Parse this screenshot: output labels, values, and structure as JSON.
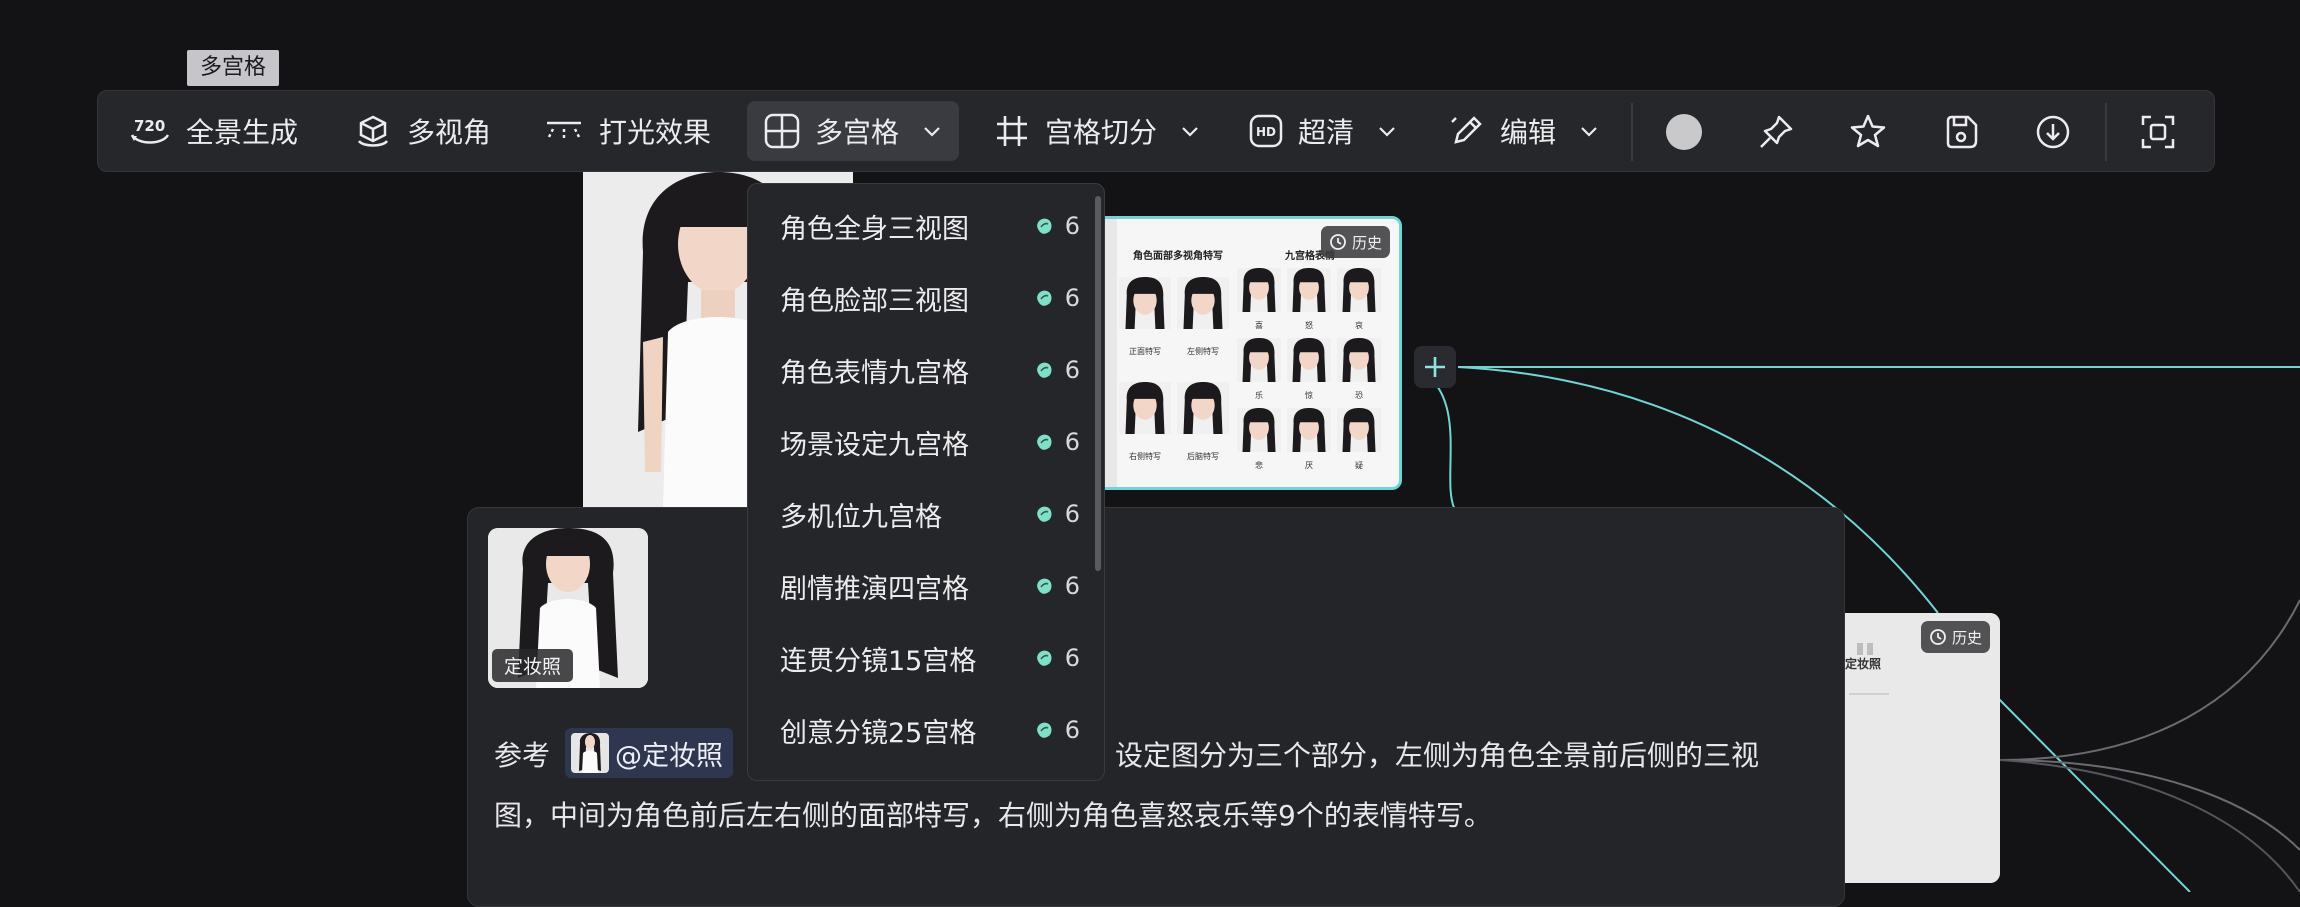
{
  "tooltip": "多宫格",
  "toolbar": {
    "items": [
      {
        "label": "全景生成",
        "icon": "720-panorama-icon"
      },
      {
        "label": "多视角",
        "icon": "cube-rotate-icon"
      },
      {
        "label": "打光效果",
        "icon": "lighting-icon"
      },
      {
        "label": "多宫格",
        "icon": "grid-icon",
        "active": true
      },
      {
        "label": "宫格切分",
        "icon": "hash-split-icon"
      },
      {
        "label": "超清",
        "icon": "hd-icon"
      },
      {
        "label": "编辑",
        "icon": "pen-edit-icon"
      }
    ],
    "right_icons": [
      "color-circle-icon",
      "pin-icon",
      "star-icon",
      "save-icon",
      "download-icon",
      "fit-screen-icon"
    ]
  },
  "dropdown": {
    "cost_icon": "bean-icon",
    "items": [
      {
        "label": "角色全身三视图",
        "cost": "6"
      },
      {
        "label": "角色脸部三视图",
        "cost": "6"
      },
      {
        "label": "角色表情九宫格",
        "cost": "6"
      },
      {
        "label": "场景设定九宫格",
        "cost": "6"
      },
      {
        "label": "多机位九宫格",
        "cost": "6"
      },
      {
        "label": "剧情推演四宫格",
        "cost": "6"
      },
      {
        "label": "连贯分镜15宫格",
        "cost": "6"
      },
      {
        "label": "创意分镜25宫格",
        "cost": "6"
      }
    ]
  },
  "grid_card": {
    "history": "历史",
    "left_title": "角色面部多视角特写",
    "right_title": "九宫格表情",
    "face_labels": [
      "正面特写",
      "左侧特写",
      "右侧特写",
      "后脑特写"
    ],
    "emotion_labels": [
      "喜",
      "怒",
      "哀",
      "乐",
      "惊",
      "恐",
      "悲",
      "厌",
      "疑"
    ]
  },
  "right_card": {
    "history": "历史",
    "title": "定妆照"
  },
  "editor": {
    "thumb_label": "定妆照",
    "prefix": "参考",
    "chip_label": "@定妆照",
    "line1_rest": "设定图分为三个部分，左侧为角色全景前后侧的三视",
    "line2": "图，中间为角色前后左右侧的面部特写，右侧为角色喜怒哀乐等9个的表情特写。"
  },
  "colors": {
    "accent": "#6fd6d6",
    "background": "#131316",
    "panel": "#26272b"
  }
}
